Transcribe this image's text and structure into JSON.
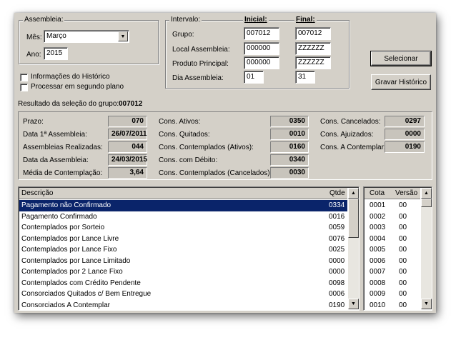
{
  "assembleia": {
    "legend": "Assembleia:",
    "mes_label": "Mês:",
    "mes_value": "Março",
    "ano_label": "Ano:",
    "ano_value": "2015"
  },
  "options": {
    "info_historico": "Informações do Histórico",
    "processar": "Processar em segundo plano"
  },
  "intervalo": {
    "legend": "Intervalo:",
    "inicial_header": "Inicial:",
    "final_header": "Final:",
    "rows": [
      {
        "label": "Grupo:",
        "inicial": "007012",
        "final": "007012"
      },
      {
        "label": "Local Assembleia:",
        "inicial": "000000",
        "final": "ZZZZZZ"
      },
      {
        "label": "Produto Principal:",
        "inicial": "000000",
        "final": "ZZZZZZ"
      },
      {
        "label": "Dia Assembleia:",
        "inicial": "01",
        "final": "31"
      }
    ]
  },
  "buttons": {
    "selecionar": "Selecionar",
    "gravar": "Gravar Histórico"
  },
  "resultado": {
    "label": "Resultado da seleção do grupo:",
    "grupo": "007012"
  },
  "stats": {
    "col1": [
      {
        "label": "Prazo:",
        "value": "070"
      },
      {
        "label": "Data 1ª Assembleia:",
        "value": "26/07/2011"
      },
      {
        "label": "Assembleias Realizadas:",
        "value": "044"
      },
      {
        "label": "Data da Assembleia:",
        "value": "24/03/2015"
      },
      {
        "label": "Média de Contemplação:",
        "value": "3,64"
      }
    ],
    "col2": [
      {
        "label": "Cons. Ativos:",
        "value": "0350"
      },
      {
        "label": "Cons. Quitados:",
        "value": "0010"
      },
      {
        "label": "Cons. Contemplados (Ativos):",
        "value": "0160"
      },
      {
        "label": "Cons. com Débito:",
        "value": "0340"
      },
      {
        "label": "Cons. Contemplados (Cancelados):",
        "value": "0030"
      }
    ],
    "col3": [
      {
        "label": "Cons. Cancelados:",
        "value": "0297"
      },
      {
        "label": "Cons. Ajuizados:",
        "value": "0000"
      },
      {
        "label": "Cons. A Contemplar:",
        "value": "0190"
      }
    ]
  },
  "table_main": {
    "headers": {
      "descricao": "Descrição",
      "qtde": "Qtde"
    },
    "rows": [
      {
        "descricao": "Pagamento não Confirmado",
        "qtde": "0334"
      },
      {
        "descricao": "Pagamento Confirmado",
        "qtde": "0016"
      },
      {
        "descricao": "Contemplados por Sorteio",
        "qtde": "0059"
      },
      {
        "descricao": "Contemplados por Lance Livre",
        "qtde": "0076"
      },
      {
        "descricao": "Contemplados por Lance Fixo",
        "qtde": "0025"
      },
      {
        "descricao": "Contemplados por Lance Limitado",
        "qtde": "0000"
      },
      {
        "descricao": "Contemplados por 2 Lance Fixo",
        "qtde": "0000"
      },
      {
        "descricao": "Contemplados com Crédito Pendente",
        "qtde": "0098"
      },
      {
        "descricao": "Consorciados Quitados c/ Bem Entregue",
        "qtde": "0006"
      },
      {
        "descricao": "Consorciados A Contemplar",
        "qtde": "0190"
      }
    ]
  },
  "table_cota": {
    "headers": {
      "cota": "Cota",
      "versao": "Versão"
    },
    "rows": [
      {
        "cota": "0001",
        "versao": "00"
      },
      {
        "cota": "0002",
        "versao": "00"
      },
      {
        "cota": "0003",
        "versao": "00"
      },
      {
        "cota": "0004",
        "versao": "00"
      },
      {
        "cota": "0005",
        "versao": "00"
      },
      {
        "cota": "0006",
        "versao": "00"
      },
      {
        "cota": "0007",
        "versao": "00"
      },
      {
        "cota": "0008",
        "versao": "00"
      },
      {
        "cota": "0009",
        "versao": "00"
      },
      {
        "cota": "0010",
        "versao": "00"
      }
    ]
  },
  "colors": {
    "window": "#d4d0c8",
    "selection": "#0a246a"
  },
  "icons": {
    "dropdown": "chevron-down-icon",
    "scroll_up": "arrow-up-icon",
    "scroll_down": "arrow-down-icon"
  }
}
